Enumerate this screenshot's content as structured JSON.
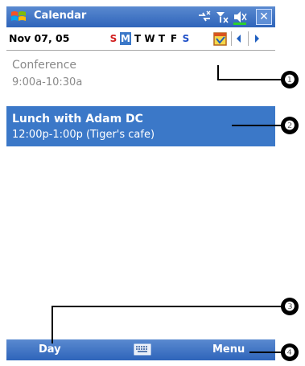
{
  "titlebar": {
    "app_title": "Calendar",
    "icons": [
      "windows-start-icon",
      "connectivity-icon",
      "signal-icon",
      "speaker-mute-icon",
      "battery-icon"
    ],
    "close_label": "✕"
  },
  "datebar": {
    "date": "Nov 07, 05",
    "days": [
      "S",
      "M",
      "T",
      "W",
      "T",
      "F",
      "S"
    ],
    "selected_day_index": 1
  },
  "appointments": [
    {
      "title": "Conference",
      "time": "9:00a-10:30a",
      "selected": false
    },
    {
      "title": "Lunch with Adam DC",
      "time": "12:00p-1:00p (Tiger's cafe)",
      "selected": true
    }
  ],
  "cmdbar": {
    "left_label": "Day",
    "right_label": "Menu",
    "center_icon": "keyboard-icon"
  },
  "callouts": [
    "❶",
    "❷",
    "❸",
    "❹"
  ],
  "colors": {
    "bar_top": "#5a8ad0",
    "bar_bottom": "#2e64ba",
    "selection": "#3b78c8",
    "weekend_red": "#d11e1e",
    "weekend_blue": "#2050c8"
  }
}
